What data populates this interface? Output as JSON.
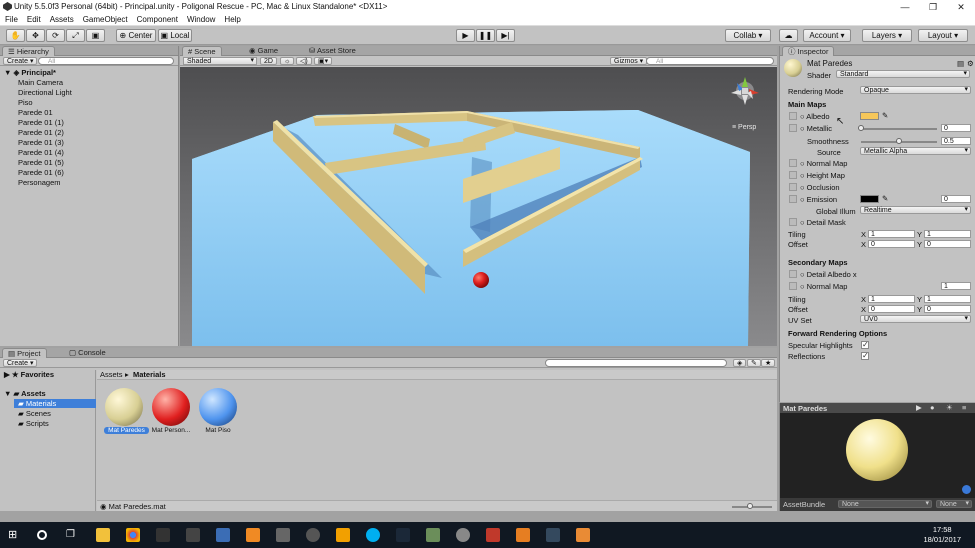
{
  "window": {
    "title": "Unity 5.5.0f3 Personal (64bit) - Principal.unity - Poligonal Rescue - PC, Mac & Linux Standalone* <DX11>",
    "minimize": "—",
    "maximize": "❐",
    "close": "✕"
  },
  "menu": [
    "File",
    "Edit",
    "Assets",
    "GameObject",
    "Component",
    "Window",
    "Help"
  ],
  "toolbar": {
    "pivot": "Center",
    "space": "Local",
    "collab": "Collab ▾",
    "account": "Account",
    "layers": "Layers",
    "layout": "Layout"
  },
  "hierarchy": {
    "tab": "Hierarchy",
    "create": "Create ▾",
    "search_placeholder": "All",
    "scene": "Principal*",
    "items": [
      "Main Camera",
      "Directional Light",
      "Piso",
      "Parede 01",
      "Parede 01 (1)",
      "Parede 01 (2)",
      "Parede 01 (3)",
      "Parede 01 (4)",
      "Parede 01 (5)",
      "Parede 01 (6)",
      "Personagem"
    ]
  },
  "scene": {
    "tabs": [
      "Scene",
      "Game",
      "Asset Store"
    ],
    "shading": "Shaded",
    "mode2d": "2D",
    "gizmos": "Gizmos ▾",
    "search_placeholder": "All",
    "persp": "≡ Persp",
    "colors": {
      "sky_top": "#4e4e50",
      "sky_bottom": "#8a8a8c",
      "floor": "#86c8f2",
      "floor_light": "#a9dcfb",
      "wall": "#d8c483",
      "wall_side": "#b8a268",
      "ball": "#dd1f1f"
    }
  },
  "project": {
    "tabs": [
      "Project",
      "Console"
    ],
    "create": "Create ▾",
    "favorites": "Favorites",
    "assets": "Assets",
    "folders": [
      "Materials",
      "Scenes",
      "Scripts"
    ],
    "breadcrumb": [
      "Assets",
      "Materials"
    ],
    "items": [
      {
        "label": "Mat Paredes",
        "color": "#d8cf94"
      },
      {
        "label": "Mat Person...",
        "color": "#e01f1f"
      },
      {
        "label": "Mat Piso",
        "color": "#4f94ee"
      }
    ],
    "footer": "Mat Paredes.mat"
  },
  "inspector": {
    "tab": "Inspector",
    "material_name": "Mat Paredes",
    "shader_label": "Shader",
    "shader_value": "Standard",
    "rendering_mode_label": "Rendering Mode",
    "rendering_mode_value": "Opaque",
    "main_maps": "Main Maps",
    "albedo": "Albedo",
    "albedo_color": "#f6c75a",
    "metallic": "Metallic",
    "metallic_value": "0",
    "metallic_level": 0,
    "smoothness": "Smoothness",
    "smoothness_value": "0.5",
    "smoothness_level": 0.5,
    "source_label": "Source",
    "source_value": "Metallic Alpha",
    "normal_map": "Normal Map",
    "height_map": "Height Map",
    "occlusion": "Occlusion",
    "emission": "Emission",
    "emission_value": "0",
    "emission_color": "#000000",
    "global_illum_label": "Global Illum",
    "global_illum_value": "Realtime",
    "detail_mask": "Detail Mask",
    "tiling": "Tiling",
    "offset": "Offset",
    "tiling_x": "1",
    "tiling_y": "1",
    "offset_x": "0",
    "offset_y": "0",
    "secondary_maps": "Secondary Maps",
    "detail_albedo": "Detail Albedo x",
    "normal_map2": "Normal Map",
    "normal_map2_value": "1",
    "tiling2_x": "1",
    "tiling2_y": "1",
    "offset2_x": "0",
    "offset2_y": "0",
    "uv_set_label": "UV Set",
    "uv_set_value": "UV0",
    "forward_options": "Forward Rendering Options",
    "specular": "Specular Highlights",
    "specular_checked": true,
    "reflections": "Reflections",
    "reflections_checked": true,
    "x": "X",
    "y": "Y"
  },
  "preview": {
    "title": "Mat Paredes",
    "asset_bundle": "AssetBundle",
    "none1": "None",
    "none2": "None",
    "sphere_color": "#f0e08a"
  },
  "taskbar": {
    "time": "17:58",
    "date": "18/01/2017"
  }
}
